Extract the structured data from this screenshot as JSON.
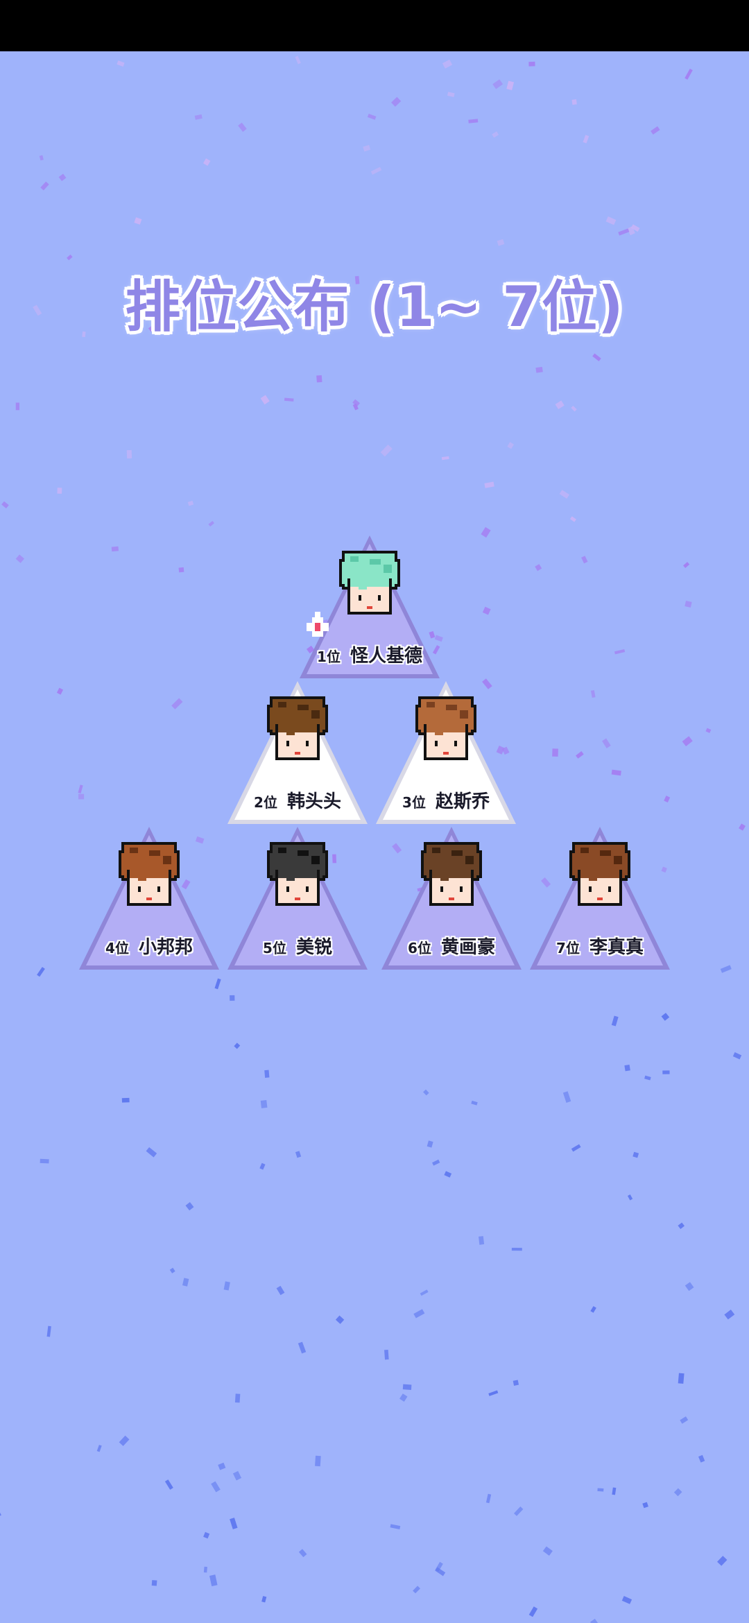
{
  "title": "排位公布 (1~ 7位)",
  "colors": {
    "background": "#9fb3fb",
    "status_bar": "#000000",
    "title_fill": "#8f86e6",
    "card_purple": "#b3aef5",
    "card_white": "#ffffff",
    "confetti_purple": "#a47ff2",
    "confetti_blue": "#5f78ef"
  },
  "rankings": [
    {
      "rank": "1位",
      "name": "怪人基德",
      "card_style": "purple",
      "hair": "#8ae5c7",
      "hair_dark": "#5cc8a8",
      "crown": true
    },
    {
      "rank": "2位",
      "name": "韩头头",
      "card_style": "white",
      "hair": "#7a4a1e",
      "hair_dark": "#4a2a10"
    },
    {
      "rank": "3位",
      "name": "赵斯乔",
      "card_style": "white",
      "hair": "#b46a3a",
      "hair_dark": "#7a4020"
    },
    {
      "rank": "4位",
      "name": "小邦邦",
      "card_style": "purple",
      "hair": "#a8582a",
      "hair_dark": "#6a3214"
    },
    {
      "rank": "5位",
      "name": "美锐",
      "card_style": "purple",
      "hair": "#3a3a3a",
      "hair_dark": "#111111"
    },
    {
      "rank": "6位",
      "name": "黄画豪",
      "card_style": "purple",
      "hair": "#6a4226",
      "hair_dark": "#3a2210"
    },
    {
      "rank": "7位",
      "name": "李真真",
      "card_style": "purple",
      "hair": "#8a4a26",
      "hair_dark": "#55280f"
    }
  ]
}
